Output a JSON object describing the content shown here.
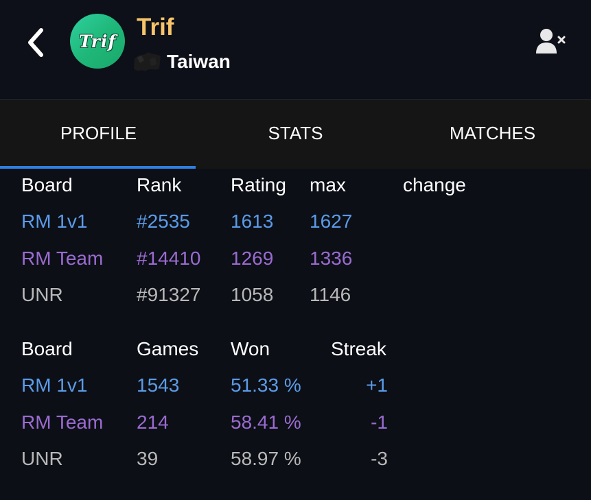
{
  "header": {
    "player_name": "Trif",
    "avatar_text": "Trif",
    "country": "Taiwan"
  },
  "tabs": [
    {
      "label": "PROFILE",
      "active": true
    },
    {
      "label": "STATS",
      "active": false
    },
    {
      "label": "MATCHES",
      "active": false
    }
  ],
  "ratings_table": {
    "headers": [
      "Board",
      "Rank",
      "Rating",
      "max",
      "change"
    ],
    "rows": [
      {
        "board": "RM 1v1",
        "rank": "#2535",
        "rating": "1613",
        "max": "1627",
        "change": ""
      },
      {
        "board": "RM Team",
        "rank": "#14410",
        "rating": "1269",
        "max": "1336",
        "change": ""
      },
      {
        "board": "UNR",
        "rank": "#91327",
        "rating": "1058",
        "max": "1146",
        "change": ""
      }
    ]
  },
  "games_table": {
    "headers": [
      "Board",
      "Games",
      "Won",
      "Streak"
    ],
    "rows": [
      {
        "board": "RM 1v1",
        "games": "1543",
        "won": "51.33 %",
        "streak": "+1"
      },
      {
        "board": "RM Team",
        "games": "214",
        "won": "58.41 %",
        "streak": "-1"
      },
      {
        "board": "UNR",
        "games": "39",
        "won": "58.97 %",
        "streak": "-3"
      }
    ]
  },
  "colors": {
    "accent": "#2f7fe0",
    "name": "#f7c46a",
    "rm_1v1": "#5b9be8",
    "rm_team": "#9a6bd0",
    "unr": "#b8b8b8"
  },
  "icons": {
    "back": "chevron-left-icon",
    "unfollow": "person-remove-icon",
    "flag": "flag-icon"
  }
}
